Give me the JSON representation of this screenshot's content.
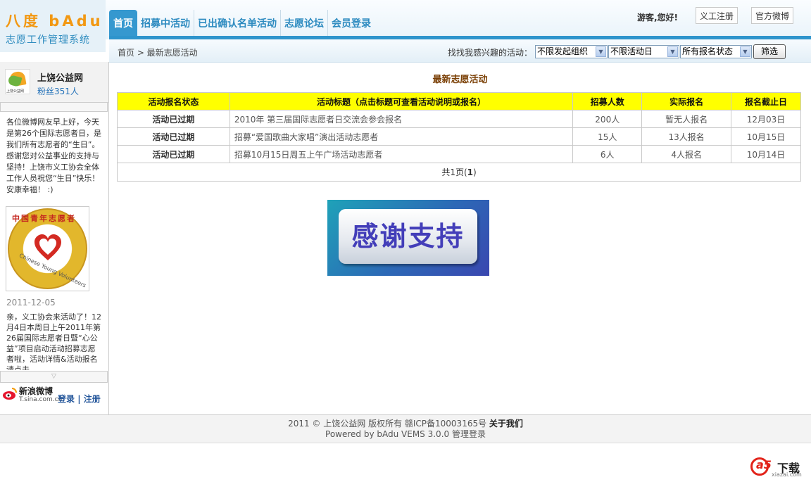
{
  "logo": {
    "line1": "八度 bAdu",
    "line2": "志愿工作管理系统"
  },
  "nav": [
    {
      "label": "首页",
      "active": true
    },
    {
      "label": "招募中活动",
      "active": false
    },
    {
      "label": "已出确认名单活动",
      "active": false
    },
    {
      "label": "志愿论坛",
      "active": false
    },
    {
      "label": "会员登录",
      "active": false
    }
  ],
  "header": {
    "greeting": "游客,您好!",
    "yigong_button": "义工注册",
    "weibo_button": "官方微博"
  },
  "breadcrumb": {
    "text": "首页 > 最新志愿活动"
  },
  "filter": {
    "label": "找找我感兴趣的活动：",
    "org_value": "不限发起组织",
    "day_value": "不限活动日",
    "status_value": "所有报名状态",
    "button": "筛选"
  },
  "sidebar": {
    "avatar_text": "上饶公益网",
    "name": "上饶公益网",
    "fans": "粉丝351人",
    "message1": "各位微博网友早上好，今天是第26个国际志愿者日，是我们所有志愿者的“生日”。感谢您对公益事业的支持与坚持！上饶市义工协会全体工作人员祝您“生日”快乐！安康幸福！ :)",
    "image_ring_text": "中国青年志愿者",
    "image_eng_text": "Chinese Young Volunteers",
    "date": "2011-12-05",
    "message2": "亲，义工协会来活动了！12月4日本周日上午2011年第26届国际志愿者日暨“心公益”项目启动活动招募志愿者啦，活动详情&活动报名请点击",
    "scroll_glyph": "▽",
    "sina_label": "新浪微博",
    "sina_sub": "T.sina.com.cn",
    "login": "登录",
    "separator": "|",
    "register": "注册"
  },
  "main": {
    "title": "最新志愿活动",
    "columns": [
      "活动报名状态",
      "活动标题（点击标题可查看活动说明或报名）",
      "招募人数",
      "实际报名",
      "报名截止日"
    ],
    "rows": [
      {
        "status": "活动已过期",
        "title": "2010年 第三届国际志愿者日交流会参会报名",
        "recruit": "200人",
        "actual": "暂无人报名",
        "deadline": "12月03日"
      },
      {
        "status": "活动已过期",
        "title": "招募“爱国歌曲大家唱”演出活动志愿者",
        "recruit": "15人",
        "actual": "13人报名",
        "deadline": "10月15日"
      },
      {
        "status": "活动已过期",
        "title": "招募10月15日周五上午广场活动志愿者",
        "recruit": "6人",
        "actual": "4人报名",
        "deadline": "10月14日"
      }
    ],
    "pager_prefix": "共1页(",
    "pager_page": "1",
    "pager_suffix": ")",
    "thanks_banner": "感谢支持"
  },
  "footer": {
    "line1": "2011 © 上饶公益网 版权所有 赣ICP备10003165号",
    "about": "关于我们",
    "line2": "Powered by bAdu VEMS 3.0.0 管理登录"
  },
  "watermark": {
    "logo": "a5",
    "label": "下载",
    "sub": "xiazai.com"
  }
}
